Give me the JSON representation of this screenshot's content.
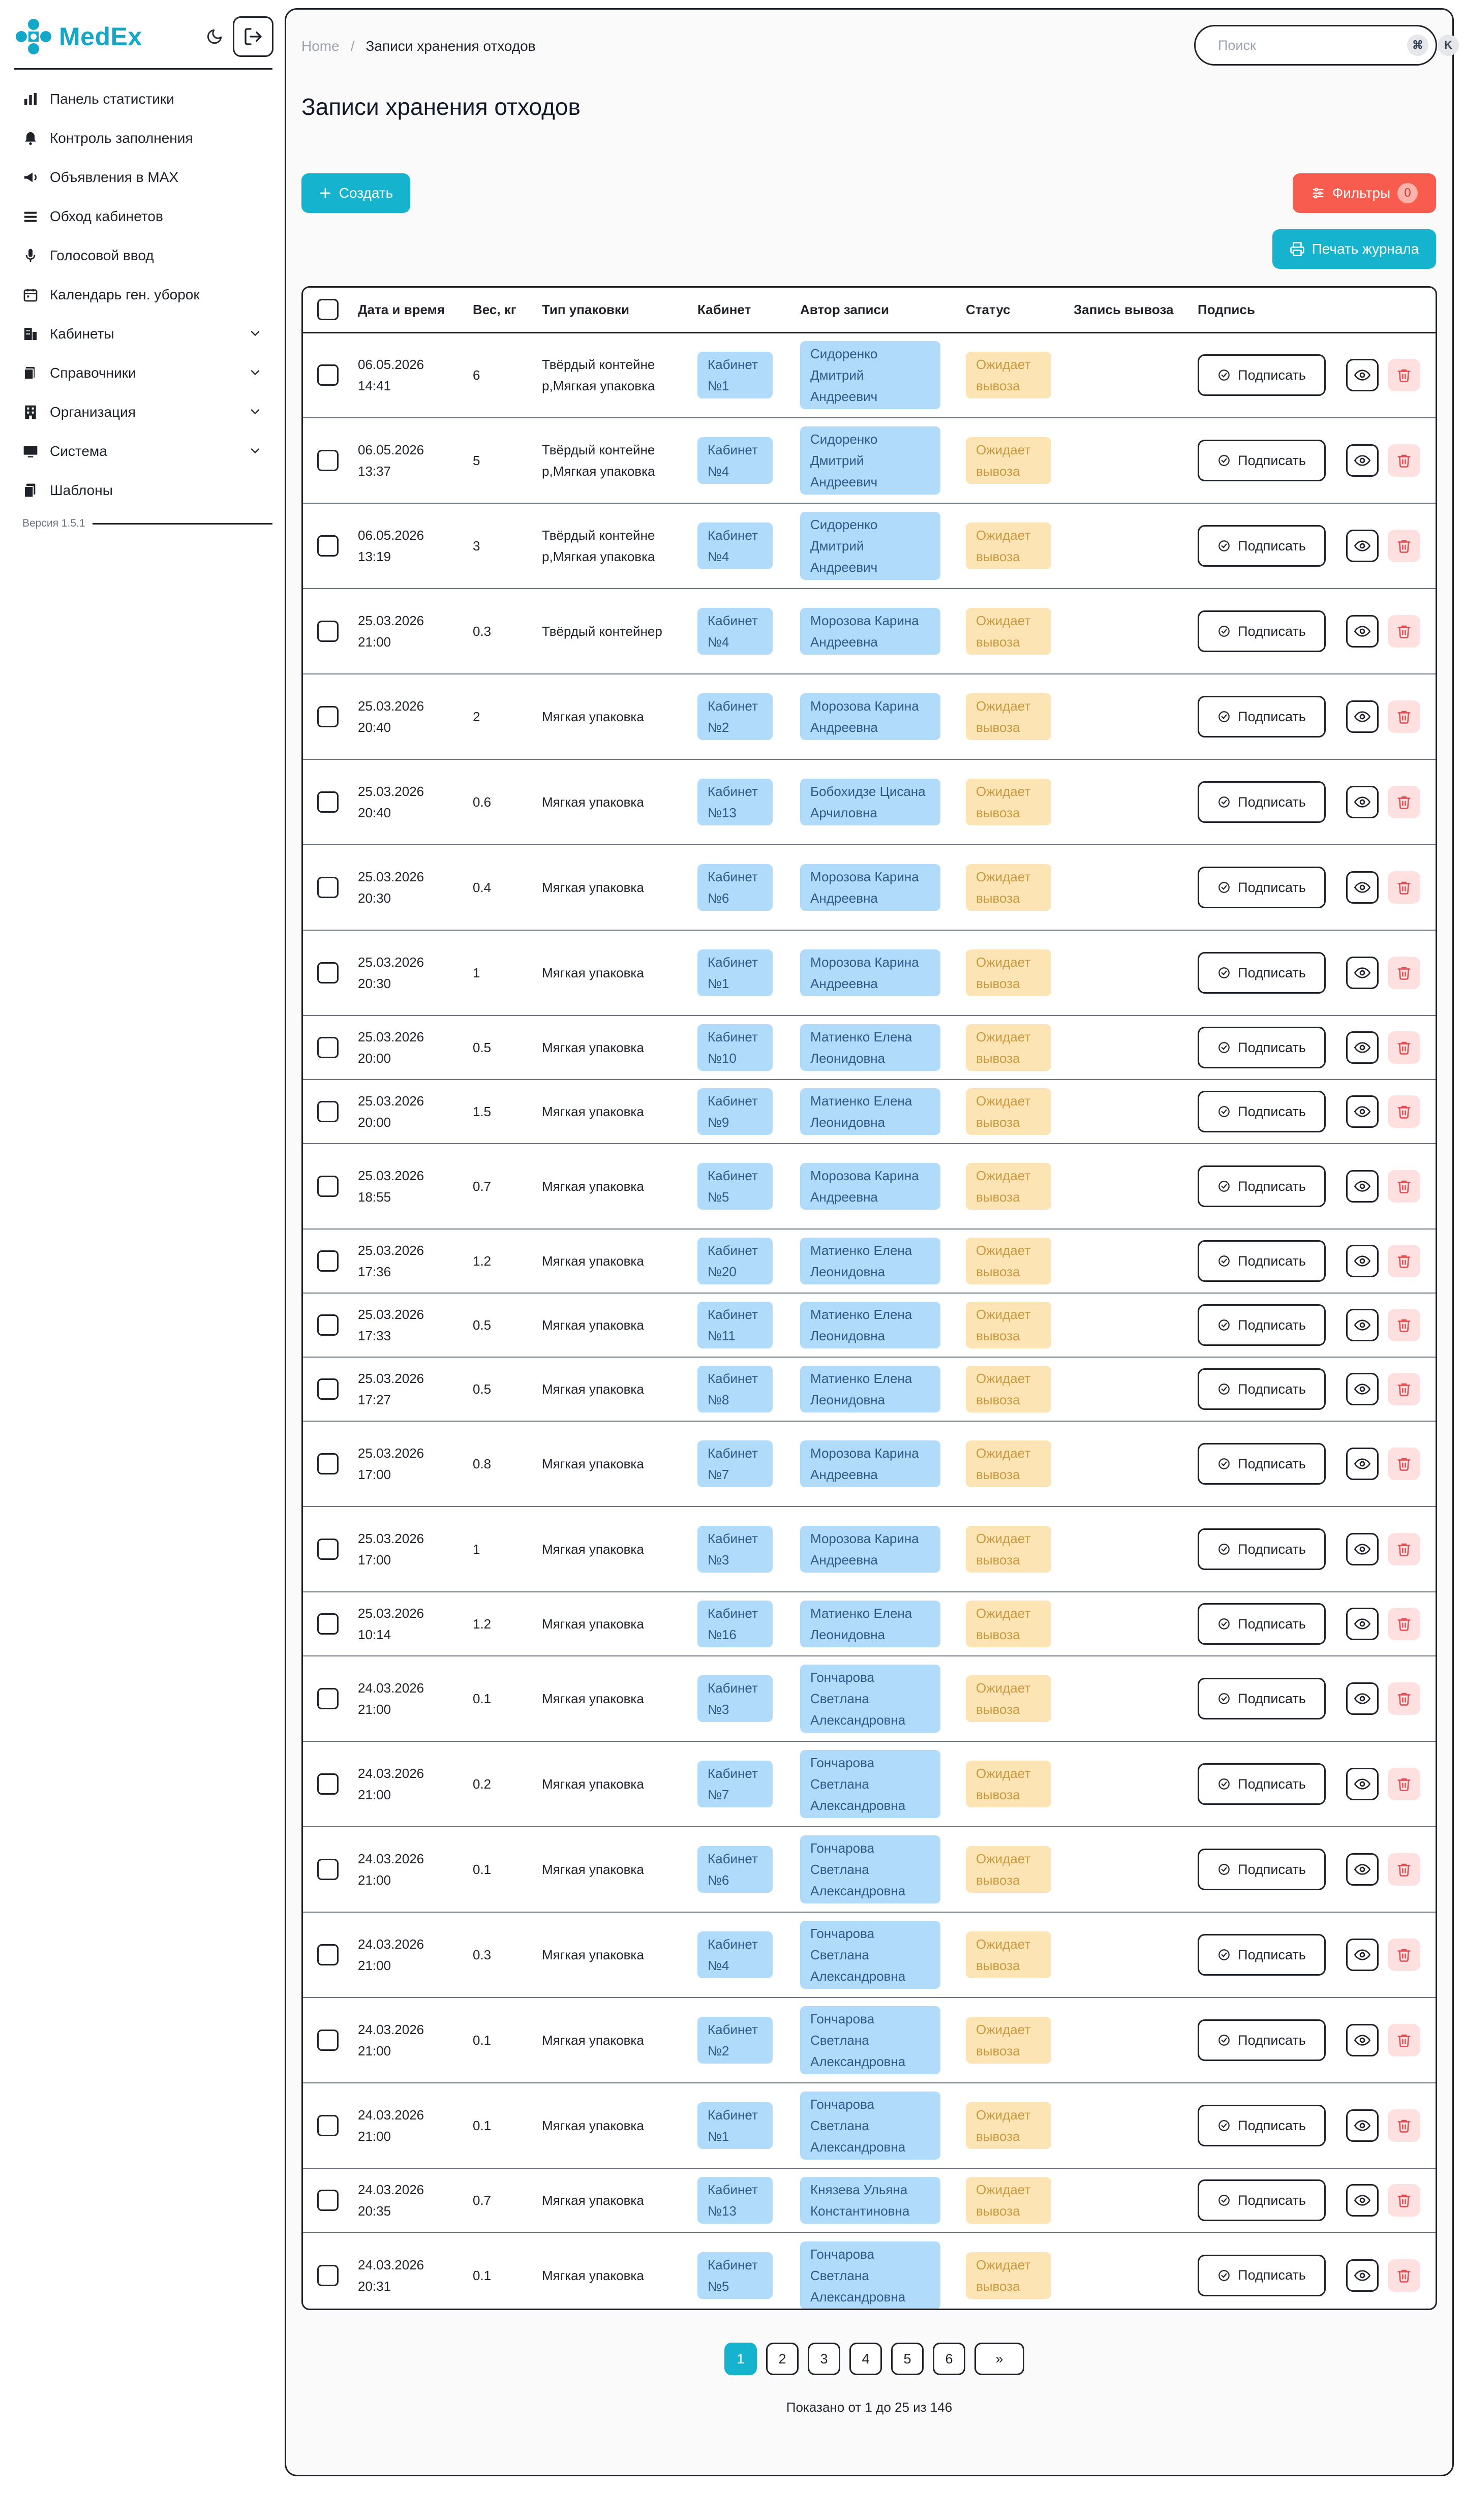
{
  "app": {
    "brand": "MedEx",
    "version": "Версия 1.5.1",
    "accent": "#16b3cf",
    "danger": "#f75c4f"
  },
  "sidebar": {
    "items": [
      {
        "label": "Панель статистики",
        "icon": "bar-chart-icon",
        "expandable": false
      },
      {
        "label": "Контроль заполнения",
        "icon": "bell-icon",
        "expandable": false
      },
      {
        "label": "Объявления в MAX",
        "icon": "megaphone-icon",
        "expandable": false
      },
      {
        "label": "Обход кабинетов",
        "icon": "list-icon",
        "expandable": false
      },
      {
        "label": "Голосовой ввод",
        "icon": "microphone-icon",
        "expandable": false
      },
      {
        "label": "Календарь ген. уборок",
        "icon": "calendar-icon",
        "expandable": false
      },
      {
        "label": "Кабинеты",
        "icon": "building-icon",
        "expandable": true
      },
      {
        "label": "Справочники",
        "icon": "book-icon",
        "expandable": true
      },
      {
        "label": "Организация",
        "icon": "organization-icon",
        "expandable": true
      },
      {
        "label": "Система",
        "icon": "monitor-icon",
        "expandable": true
      },
      {
        "label": "Шаблоны",
        "icon": "templates-icon",
        "expandable": false
      }
    ]
  },
  "breadcrumb": {
    "home": "Home",
    "separator": "/",
    "current": "Записи хранения отходов"
  },
  "search": {
    "placeholder": "Поиск",
    "shortcut_mod": "⌘",
    "shortcut_key": "K"
  },
  "page": {
    "title": "Записи хранения отходов"
  },
  "toolbar": {
    "create_label": "Создать",
    "filters_label": "Фильтры",
    "filters_count": "0",
    "print_label": "Печать журнала"
  },
  "table": {
    "headers": [
      "Дата и время",
      "Вес, кг",
      "Тип упаковки",
      "Кабинет",
      "Автор записи",
      "Статус",
      "Запись вывоза",
      "Подпись"
    ],
    "sign_label": "Подписать",
    "rows": [
      {
        "date": "06.05.2026",
        "time": "14:41",
        "weight": "6",
        "pack": "Твёрдый контейнер,Мягкая упаковка",
        "room": "Кабинет №1",
        "author": "Сидоренко Дмитрий Андреевич",
        "status": "Ожидает вывоза",
        "h": 168
      },
      {
        "date": "06.05.2026",
        "time": "13:37",
        "weight": "5",
        "pack": "Твёрдый контейнер,Мягкая упаковка",
        "room": "Кабинет №4",
        "author": "Сидоренко Дмитрий Андреевич",
        "status": "Ожидает вывоза",
        "h": 168
      },
      {
        "date": "06.05.2026",
        "time": "13:19",
        "weight": "3",
        "pack": "Твёрдый контейнер,Мягкая упаковка",
        "room": "Кабинет №4",
        "author": "Сидоренко Дмитрий Андреевич",
        "status": "Ожидает вывоза",
        "h": 168
      },
      {
        "date": "25.03.2026",
        "time": "21:00",
        "weight": "0.3",
        "pack": "Твёрдый контейнер",
        "room": "Кабинет №4",
        "author": "Морозова Карина Андреевна",
        "status": "Ожидает вывоза",
        "h": 168
      },
      {
        "date": "25.03.2026",
        "time": "20:40",
        "weight": "2",
        "pack": "Мягкая упаковка",
        "room": "Кабинет №2",
        "author": "Морозова Карина Андреевна",
        "status": "Ожидает вывоза",
        "h": 168
      },
      {
        "date": "25.03.2026",
        "time": "20:40",
        "weight": "0.6",
        "pack": "Мягкая упаковка",
        "room": "Кабинет №13",
        "author": "Бобохидзе Цисана Арчиловна",
        "status": "Ожидает вывоза",
        "h": 168
      },
      {
        "date": "25.03.2026",
        "time": "20:30",
        "weight": "0.4",
        "pack": "Мягкая упаковка",
        "room": "Кабинет №6",
        "author": "Морозова Карина Андреевна",
        "status": "Ожидает вывоза",
        "h": 168
      },
      {
        "date": "25.03.2026",
        "time": "20:30",
        "weight": "1",
        "pack": "Мягкая упаковка",
        "room": "Кабинет №1",
        "author": "Морозова Карина Андреевна",
        "status": "Ожидает вывоза",
        "h": 168
      },
      {
        "date": "25.03.2026",
        "time": "20:00",
        "weight": "0.5",
        "pack": "Мягкая упаковка",
        "room": "Кабинет №10",
        "author": "Матиенко Елена Леонидовна",
        "status": "Ожидает вывоза",
        "h": 126
      },
      {
        "date": "25.03.2026",
        "time": "20:00",
        "weight": "1.5",
        "pack": "Мягкая упаковка",
        "room": "Кабинет №9",
        "author": "Матиенко Елена Леонидовна",
        "status": "Ожидает вывоза",
        "h": 126
      },
      {
        "date": "25.03.2026",
        "time": "18:55",
        "weight": "0.7",
        "pack": "Мягкая упаковка",
        "room": "Кабинет №5",
        "author": "Морозова Карина Андреевна",
        "status": "Ожидает вывоза",
        "h": 168
      },
      {
        "date": "25.03.2026",
        "time": "17:36",
        "weight": "1.2",
        "pack": "Мягкая упаковка",
        "room": "Кабинет №20",
        "author": "Матиенко Елена Леонидовна",
        "status": "Ожидает вывоза",
        "h": 126
      },
      {
        "date": "25.03.2026",
        "time": "17:33",
        "weight": "0.5",
        "pack": "Мягкая упаковка",
        "room": "Кабинет №11",
        "author": "Матиенко Елена Леонидовна",
        "status": "Ожидает вывоза",
        "h": 126
      },
      {
        "date": "25.03.2026",
        "time": "17:27",
        "weight": "0.5",
        "pack": "Мягкая упаковка",
        "room": "Кабинет №8",
        "author": "Матиенко Елена Леонидовна",
        "status": "Ожидает вывоза",
        "h": 126
      },
      {
        "date": "25.03.2026",
        "time": "17:00",
        "weight": "0.8",
        "pack": "Мягкая упаковка",
        "room": "Кабинет №7",
        "author": "Морозова Карина Андреевна",
        "status": "Ожидает вывоза",
        "h": 168
      },
      {
        "date": "25.03.2026",
        "time": "17:00",
        "weight": "1",
        "pack": "Мягкая упаковка",
        "room": "Кабинет №3",
        "author": "Морозова Карина Андреевна",
        "status": "Ожидает вывоза",
        "h": 168
      },
      {
        "date": "25.03.2026",
        "time": "10:14",
        "weight": "1.2",
        "pack": "Мягкая упаковка",
        "room": "Кабинет №16",
        "author": "Матиенко Елена Леонидовна",
        "status": "Ожидает вывоза",
        "h": 126
      },
      {
        "date": "24.03.2026",
        "time": "21:00",
        "weight": "0.1",
        "pack": "Мягкая упаковка",
        "room": "Кабинет №3",
        "author": "Гончарова Светлана Александровна",
        "status": "Ожидает вывоза",
        "h": 168
      },
      {
        "date": "24.03.2026",
        "time": "21:00",
        "weight": "0.2",
        "pack": "Мягкая упаковка",
        "room": "Кабинет №7",
        "author": "Гончарова Светлана Александровна",
        "status": "Ожидает вывоза",
        "h": 168
      },
      {
        "date": "24.03.2026",
        "time": "21:00",
        "weight": "0.1",
        "pack": "Мягкая упаковка",
        "room": "Кабинет №6",
        "author": "Гончарова Светлана Александровна",
        "status": "Ожидает вывоза",
        "h": 168
      },
      {
        "date": "24.03.2026",
        "time": "21:00",
        "weight": "0.3",
        "pack": "Мягкая упаковка",
        "room": "Кабинет №4",
        "author": "Гончарова Светлана Александровна",
        "status": "Ожидает вывоза",
        "h": 168
      },
      {
        "date": "24.03.2026",
        "time": "21:00",
        "weight": "0.1",
        "pack": "Мягкая упаковка",
        "room": "Кабинет №2",
        "author": "Гончарова Светлана Александровна",
        "status": "Ожидает вывоза",
        "h": 168
      },
      {
        "date": "24.03.2026",
        "time": "21:00",
        "weight": "0.1",
        "pack": "Мягкая упаковка",
        "room": "Кабинет №1",
        "author": "Гончарова Светлана Александровна",
        "status": "Ожидает вывоза",
        "h": 168
      },
      {
        "date": "24.03.2026",
        "time": "20:35",
        "weight": "0.7",
        "pack": "Мягкая упаковка",
        "room": "Кабинет №13",
        "author": "Князева Ульяна Константиновна",
        "status": "Ожидает вывоза",
        "h": 126
      },
      {
        "date": "24.03.2026",
        "time": "20:31",
        "weight": "0.1",
        "pack": "Мягкая упаковка",
        "room": "Кабинет №5",
        "author": "Гончарова Светлана Александровна",
        "status": "Ожидает вывоза",
        "h": 168
      }
    ]
  },
  "pagination": {
    "pages": [
      "1",
      "2",
      "3",
      "4",
      "5",
      "6"
    ],
    "active": "1",
    "next_label": "»",
    "summary": "Показано от 1 до 25 из 146"
  }
}
